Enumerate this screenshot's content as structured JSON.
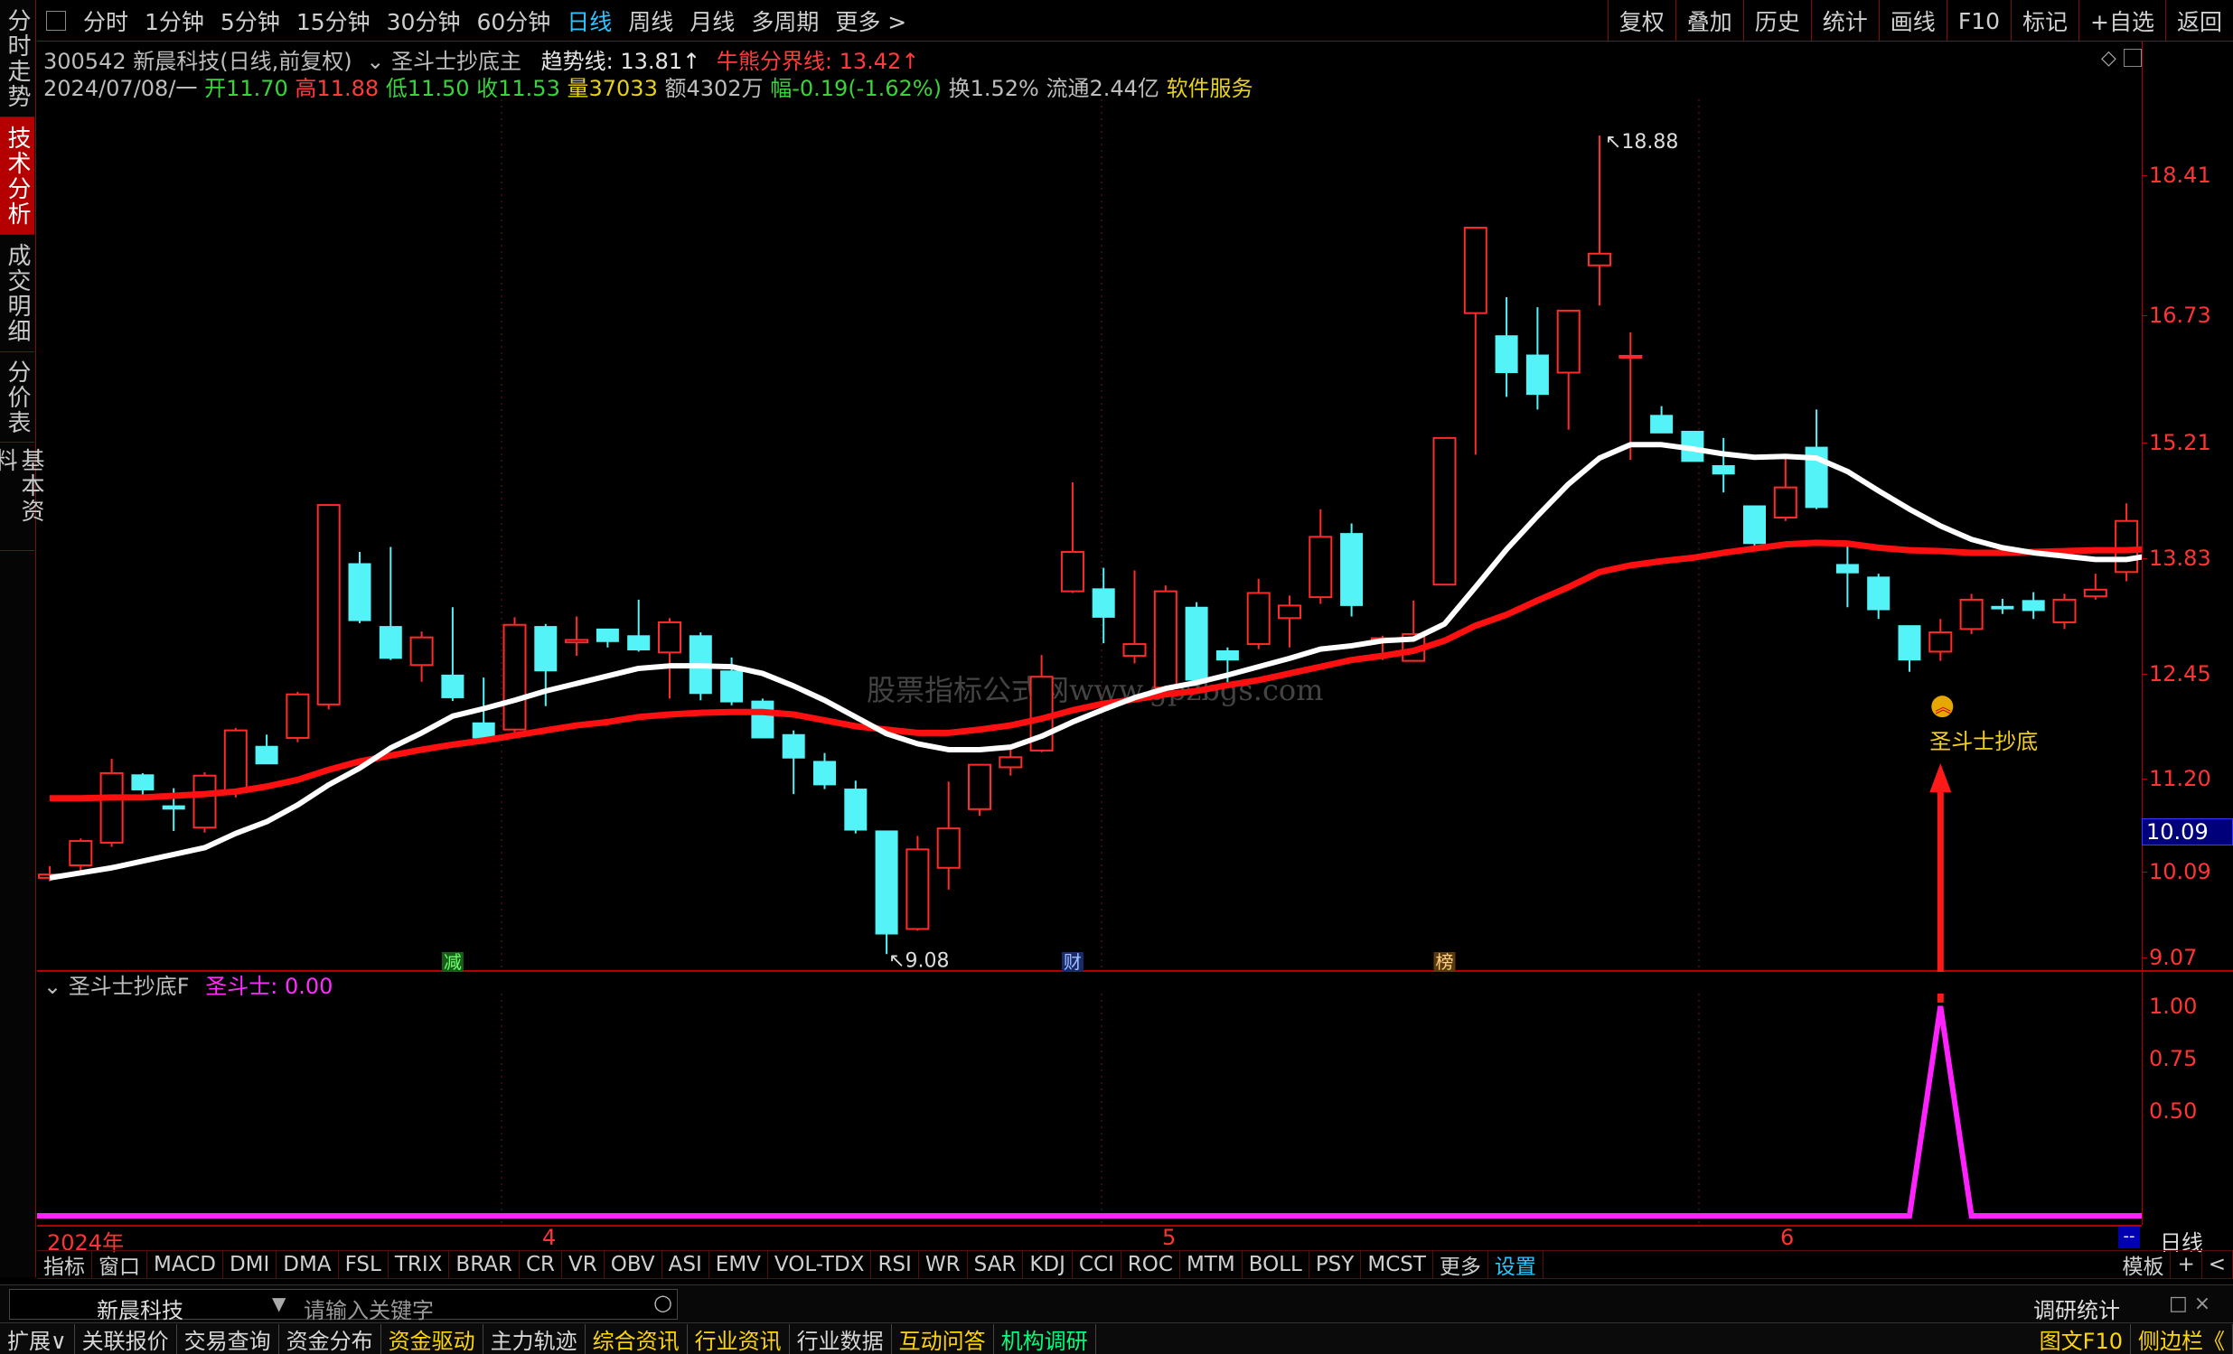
{
  "left_tabs": [
    {
      "label": "分时走势",
      "active": false
    },
    {
      "label": "技术分析",
      "active": true
    },
    {
      "label": "成交明细",
      "active": false
    },
    {
      "label": "分价表",
      "active": false
    },
    {
      "label": "基本资料",
      "active": false
    }
  ],
  "periods": [
    "分时",
    "1分钟",
    "5分钟",
    "15分钟",
    "30分钟",
    "60分钟",
    "日线",
    "周线",
    "月线",
    "多周期",
    "更多 >"
  ],
  "active_period": "日线",
  "top_right": [
    "复权",
    "叠加",
    "历史",
    "统计",
    "画线",
    "F10",
    "标记",
    "+自选",
    "返回"
  ],
  "info": {
    "code_name": "300542 新晨科技(日线,前复权)",
    "formula": "圣斗士抄底主",
    "trend_label": "趋势线:",
    "trend_value": "13.81↑",
    "bull_label": "牛熊分界线:",
    "bull_value": "13.42↑",
    "date": "2024/07/08/一",
    "open_l": "开",
    "open": "11.70",
    "high_l": "高",
    "high": "11.88",
    "low_l": "低",
    "low": "11.50",
    "close_l": "收",
    "close": "11.53",
    "vol_l": "量",
    "vol": "37033",
    "amt_l": "额",
    "amt": "4302万",
    "chg_l": "幅",
    "chg": "-0.19(-1.62%)",
    "turnover": "换1.52%",
    "float": "流通2.44亿",
    "industry": "软件服务"
  },
  "price_axis": [
    "18.41",
    "16.73",
    "15.21",
    "13.83",
    "12.45",
    "11.20",
    "10.09",
    "9.07"
  ],
  "current_price_tag": "10.09",
  "annotations": {
    "high": "18.88",
    "low": "9.08",
    "signal": "圣斗士抄底",
    "watermark": "股票指标公式网www.gpzbgs.com",
    "markers": [
      "减",
      "财",
      "榜"
    ]
  },
  "sub_indicator": {
    "name": "圣斗士抄底F",
    "line_label": "圣斗士:",
    "line_value": "0.00",
    "axis": [
      "1.00",
      "0.75",
      "0.50"
    ]
  },
  "x_axis": [
    "2024年",
    "4",
    "5",
    "6"
  ],
  "x_right_label": "日线",
  "indicators": [
    "指标",
    "窗口",
    "MACD",
    "DMI",
    "DMA",
    "FSL",
    "TRIX",
    "BRAR",
    "CR",
    "VR",
    "OBV",
    "ASI",
    "EMV",
    "VOL-TDX",
    "RSI",
    "WR",
    "SAR",
    "KDJ",
    "CCI",
    "ROC",
    "MTM",
    "BOLL",
    "PSY",
    "MCST",
    "更多",
    "设置"
  ],
  "indicator_right": [
    "模板",
    "+",
    "<"
  ],
  "search": {
    "stock": "新晨科技",
    "placeholder": "请输入关键字",
    "right": "调研统计"
  },
  "bottom_links": [
    "扩展∨",
    "关联报价",
    "交易查询",
    "资金分布",
    "资金驱动",
    "主力轨迹",
    "综合资讯",
    "行业资讯",
    "行业数据",
    "互动问答",
    "机构调研"
  ],
  "bottom_right": [
    "图文F10",
    "侧边栏《"
  ],
  "colors": {
    "up": "#ff2a2a",
    "down": "#53f3f7",
    "trend": "#ffffff",
    "bull": "#ff1010",
    "signal": "#ff22ff",
    "axis": "#b20000"
  },
  "chart_data": {
    "type": "candlestick",
    "ohlc": [
      [
        10.02,
        10.16,
        9.98,
        10.06
      ],
      [
        10.17,
        10.49,
        10.07,
        10.46
      ],
      [
        10.44,
        11.44,
        10.39,
        11.27
      ],
      [
        11.25,
        11.27,
        10.98,
        11.07
      ],
      [
        10.88,
        11.09,
        10.58,
        10.84
      ],
      [
        10.62,
        11.28,
        10.56,
        11.24
      ],
      [
        11.04,
        11.81,
        10.98,
        11.78
      ],
      [
        11.59,
        11.73,
        11.38,
        11.38
      ],
      [
        11.69,
        12.24,
        11.64,
        12.21
      ],
      [
        12.09,
        14.47,
        12.03,
        14.47
      ],
      [
        13.77,
        13.91,
        13.06,
        13.09
      ],
      [
        13.02,
        13.97,
        12.62,
        12.64
      ],
      [
        12.56,
        12.96,
        12.36,
        12.89
      ],
      [
        12.44,
        13.25,
        12.13,
        12.17
      ],
      [
        11.87,
        12.41,
        11.66,
        11.69
      ],
      [
        11.79,
        13.13,
        11.75,
        13.04
      ],
      [
        13.02,
        13.05,
        12.07,
        12.49
      ],
      [
        12.83,
        13.14,
        12.67,
        12.86
      ],
      [
        12.99,
        12.96,
        12.77,
        12.84
      ],
      [
        12.91,
        13.34,
        12.72,
        12.74
      ],
      [
        12.71,
        13.12,
        12.16,
        13.07
      ],
      [
        12.91,
        12.95,
        12.14,
        12.22
      ],
      [
        12.49,
        12.65,
        12.08,
        12.12
      ],
      [
        12.13,
        12.16,
        11.78,
        11.69
      ],
      [
        11.73,
        11.78,
        11.02,
        11.45
      ],
      [
        11.41,
        11.51,
        11.08,
        11.13
      ],
      [
        11.08,
        11.18,
        10.55,
        10.59
      ],
      [
        10.58,
        10.55,
        9.11,
        9.35
      ],
      [
        9.41,
        10.52,
        9.39,
        10.36
      ],
      [
        10.14,
        11.17,
        9.88,
        10.61
      ],
      [
        10.84,
        11.29,
        10.76,
        11.37
      ],
      [
        11.34,
        11.57,
        11.24,
        11.46
      ],
      [
        11.54,
        12.68,
        11.52,
        12.42
      ],
      [
        13.44,
        14.74,
        13.42,
        13.91
      ],
      [
        13.47,
        13.72,
        12.82,
        13.13
      ],
      [
        12.67,
        13.69,
        12.58,
        12.81
      ],
      [
        12.29,
        13.51,
        12.22,
        13.44
      ],
      [
        13.25,
        13.31,
        12.32,
        12.38
      ],
      [
        12.73,
        12.77,
        12.34,
        12.62
      ],
      [
        12.81,
        13.59,
        12.75,
        13.42
      ],
      [
        13.12,
        13.39,
        12.77,
        13.27
      ],
      [
        13.37,
        14.42,
        13.29,
        14.09
      ],
      [
        14.13,
        14.25,
        13.14,
        13.27
      ],
      [
        12.86,
        12.91,
        12.62,
        12.88
      ],
      [
        12.61,
        13.33,
        12.65,
        12.93
      ],
      [
        13.52,
        14.67,
        13.53,
        15.27
      ],
      [
        16.76,
        17.74,
        15.07,
        17.78
      ],
      [
        16.49,
        16.95,
        15.76,
        16.05
      ],
      [
        16.26,
        16.83,
        15.61,
        15.79
      ],
      [
        16.05,
        16.57,
        15.37,
        16.79
      ],
      [
        17.33,
        18.88,
        16.85,
        17.47
      ],
      [
        16.25,
        16.53,
        15.01,
        16.25
      ],
      [
        15.54,
        15.65,
        15.33,
        15.33
      ],
      [
        15.35,
        15.32,
        14.99,
        14.99
      ],
      [
        14.94,
        15.27,
        14.62,
        14.84
      ],
      [
        14.46,
        14.38,
        13.96,
        14.01
      ],
      [
        14.32,
        15.05,
        14.28,
        14.68
      ],
      [
        15.16,
        15.61,
        14.42,
        14.44
      ],
      [
        13.76,
        13.99,
        13.25,
        13.66
      ],
      [
        13.61,
        13.65,
        13.11,
        13.22
      ],
      [
        13.03,
        13.03,
        12.48,
        12.62
      ],
      [
        12.72,
        13.11,
        12.61,
        12.95
      ],
      [
        12.99,
        13.41,
        12.93,
        13.34
      ],
      [
        13.26,
        13.35,
        13.17,
        13.23
      ],
      [
        13.33,
        13.43,
        13.11,
        13.21
      ],
      [
        13.07,
        13.41,
        12.99,
        13.34
      ],
      [
        13.38,
        13.65,
        13.34,
        13.46
      ],
      [
        13.67,
        14.49,
        13.56,
        14.28
      ],
      [
        13.83,
        14.09,
        13.59,
        13.88
      ]
    ],
    "trend_line": [
      10.02,
      10.08,
      10.14,
      10.22,
      10.3,
      10.38,
      10.55,
      10.69,
      10.89,
      11.13,
      11.33,
      11.57,
      11.75,
      11.95,
      12.04,
      12.14,
      12.25,
      12.34,
      12.43,
      12.52,
      12.55,
      12.55,
      12.54,
      12.46,
      12.31,
      12.14,
      11.94,
      11.74,
      11.62,
      11.55,
      11.55,
      11.58,
      11.71,
      11.88,
      12.03,
      12.17,
      12.28,
      12.35,
      12.44,
      12.54,
      12.64,
      12.75,
      12.79,
      12.85,
      12.87,
      13.05,
      13.49,
      13.94,
      14.34,
      14.72,
      15.03,
      15.19,
      15.19,
      15.14,
      15.08,
      15.04,
      15.05,
      15.03,
      14.87,
      14.64,
      14.42,
      14.22,
      14.06,
      13.96,
      13.9,
      13.86,
      13.82,
      13.82,
      13.88
    ],
    "bull_line": [
      10.97,
      10.97,
      10.98,
      10.98,
      11.0,
      11.02,
      11.05,
      11.11,
      11.19,
      11.31,
      11.41,
      11.48,
      11.55,
      11.61,
      11.66,
      11.72,
      11.78,
      11.84,
      11.88,
      11.94,
      11.97,
      11.99,
      12.0,
      12.0,
      11.97,
      11.9,
      11.83,
      11.79,
      11.75,
      11.75,
      11.79,
      11.84,
      11.92,
      12.02,
      12.1,
      12.15,
      12.21,
      12.25,
      12.32,
      12.38,
      12.46,
      12.54,
      12.62,
      12.67,
      12.73,
      12.85,
      13.03,
      13.16,
      13.33,
      13.49,
      13.67,
      13.75,
      13.8,
      13.84,
      13.9,
      13.95,
      14.0,
      14.02,
      14.01,
      13.96,
      13.93,
      13.92,
      13.9,
      13.9,
      13.91,
      13.92,
      13.93,
      13.93,
      13.95
    ],
    "signal": {
      "index": 61,
      "value": 1,
      "baseline": 0
    },
    "ylim": [
      9.07,
      18.88
    ]
  }
}
